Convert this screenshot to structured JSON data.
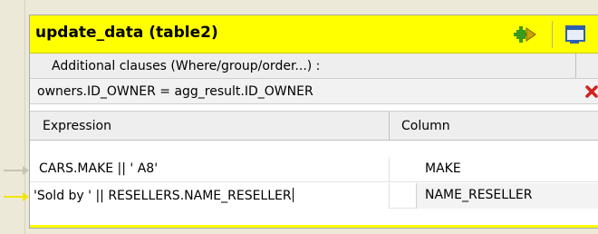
{
  "table": {
    "title": "update_data (table2)",
    "add_icon": "add-output-icon",
    "window_icon": "window-icon"
  },
  "clauses": {
    "label": "Additional clauses (Where/group/order...) :",
    "value": "owners.ID_OWNER = agg_result.ID_OWNER",
    "remove_icon": "remove-icon"
  },
  "columns": {
    "expression": "Expression",
    "column": "Column"
  },
  "rows": [
    {
      "expression": "CARS.MAKE || ' A8'",
      "column": "MAKE"
    },
    {
      "expression": "'Sold by ' || RESELLERS.NAME_RESELLER",
      "column": "NAME_RESELLER"
    }
  ],
  "colors": {
    "title_bar": "#ffff00",
    "link_arrow_active": "#f2e600",
    "link_arrow_inactive": "#c7c3b3"
  }
}
